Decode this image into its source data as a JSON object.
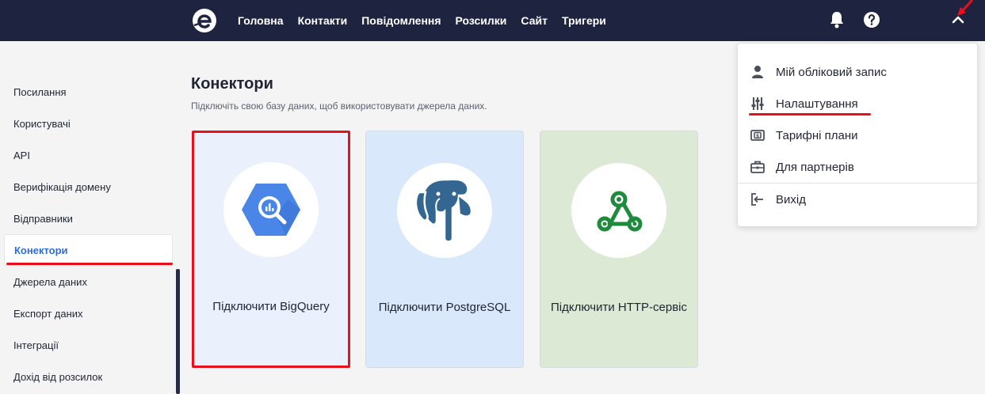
{
  "topbar": {
    "logo": "e-logo",
    "nav": [
      "Головна",
      "Контакти",
      "Повідомлення",
      "Розсилки",
      "Сайт",
      "Тригери"
    ],
    "icons": [
      "bell-icon",
      "help-icon",
      "chevron-up-icon"
    ]
  },
  "sidebar": {
    "items": [
      "Посилання",
      "Користувачі",
      "API",
      "Верифікація домену",
      "Відправники",
      "Конектори",
      "Джерела даних",
      "Експорт даних",
      "Інтеграції",
      "Дохід від розсилок"
    ],
    "active": "Конектори"
  },
  "main": {
    "title": "Конектори",
    "subtitle": "Підключіть свою базу даних, щоб використовувати джерела даних.",
    "cards": [
      {
        "label": "Підключити BigQuery",
        "icon": "bigquery-icon"
      },
      {
        "label": "Підключити PostgreSQL",
        "icon": "postgresql-icon"
      },
      {
        "label": "Підключити HTTP-сервіс",
        "icon": "webhook-icon"
      }
    ]
  },
  "dropdown": {
    "items": [
      {
        "label": "Мій обліковий запис",
        "icon": "user-icon"
      },
      {
        "label": "Налаштування",
        "icon": "sliders-icon"
      },
      {
        "label": "Тарифні плани",
        "icon": "pricing-icon"
      },
      {
        "label": "Для партнерів",
        "icon": "briefcase-icon"
      },
      {
        "label": "Вихід",
        "icon": "logout-icon"
      }
    ]
  },
  "colors": {
    "topbar": "#1e2440",
    "accent": "#2d6cdf",
    "highlight": "#e8101a"
  }
}
